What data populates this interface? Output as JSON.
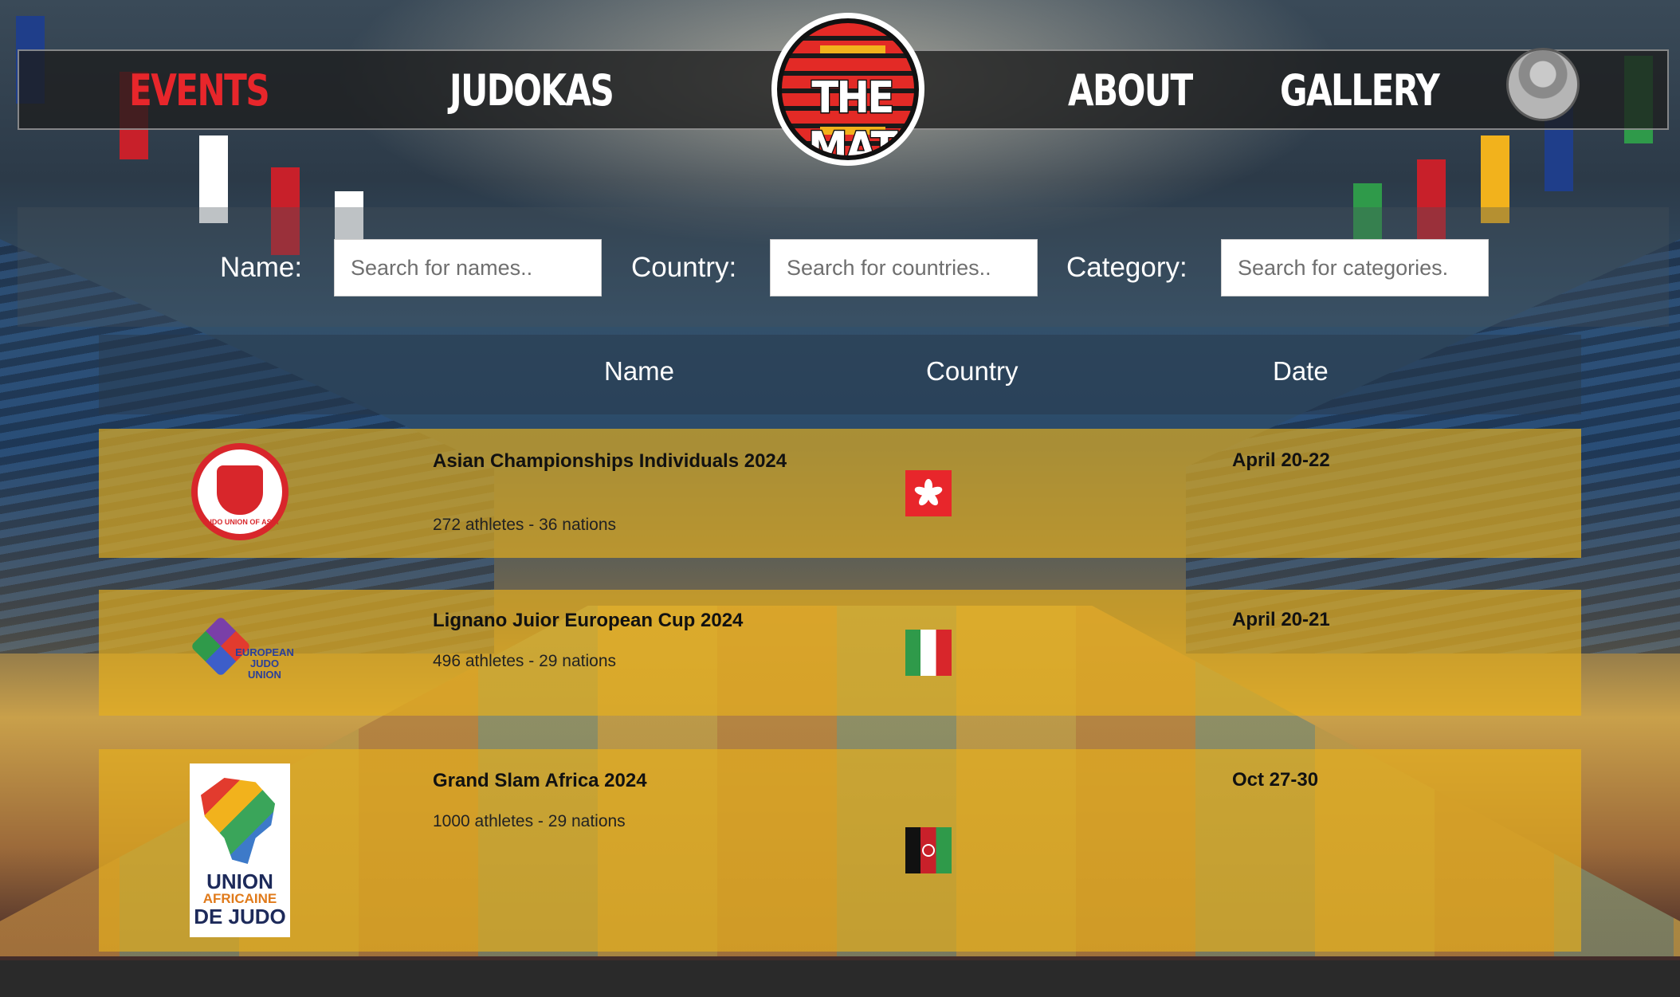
{
  "nav": {
    "items": [
      {
        "label": "EVENTS",
        "active": true
      },
      {
        "label": "JUDOKAS",
        "active": false
      },
      {
        "label": "ABOUT",
        "active": false
      },
      {
        "label": "GALLERY",
        "active": false
      }
    ],
    "logo_text": "THE MAT"
  },
  "search": {
    "name_label": "Name:",
    "name_placeholder": "Search for names..",
    "country_label": "Country:",
    "country_placeholder": "Search for countries..",
    "category_label": "Category:",
    "category_placeholder": "Search for categories."
  },
  "table": {
    "headers": [
      "Name",
      "Country",
      "Date"
    ]
  },
  "events": [
    {
      "name": "Asian Championships Individuals 2024",
      "subtitle": "272 athletes - 36 nations",
      "date": "April 20-22",
      "country_flag": "hong-kong-flag",
      "org_logo": "judo-union-of-asia-logo",
      "org_logo_text": "JUDO UNION OF ASIA"
    },
    {
      "name": "Lignano Juior European Cup 2024",
      "subtitle": "496 athletes - 29 nations",
      "date": "April 20-21",
      "country_flag": "italy-flag",
      "org_logo": "european-judo-union-logo",
      "org_logo_text": "EUROPEAN JUDO UNION"
    },
    {
      "name": "Grand Slam Africa 2024",
      "subtitle": "1000 athletes - 29 nations",
      "date": "Oct 27-30",
      "country_flag": "afghanistan-flag",
      "org_logo": "union-africaine-de-judo-logo",
      "org_logo_text": {
        "line1": "UNION",
        "line2": "AFRICAINE",
        "line3": "DE JUDO"
      }
    }
  ],
  "colors": {
    "accent_red": "#e8262b",
    "row_highlight": "#e6af1e",
    "nav_bg": "#1e1e1e"
  }
}
